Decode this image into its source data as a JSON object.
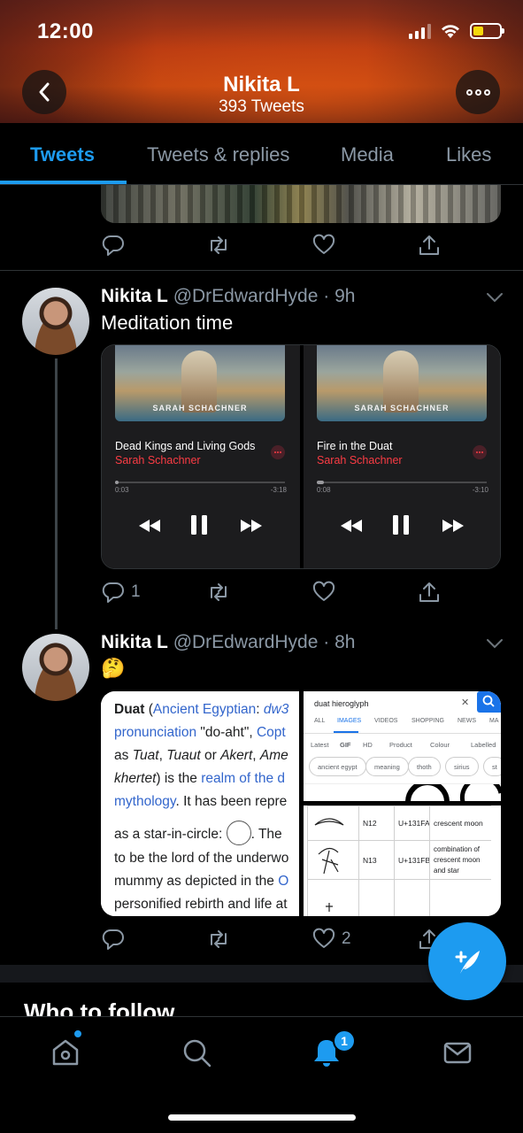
{
  "status": {
    "time": "12:00"
  },
  "header": {
    "name": "Nikita L",
    "tweet_count": "393 Tweets"
  },
  "tabs": [
    {
      "label": "Tweets",
      "active": true
    },
    {
      "label": "Tweets & replies",
      "active": false
    },
    {
      "label": "Media",
      "active": false
    },
    {
      "label": "Likes",
      "active": false
    }
  ],
  "tweets": [
    {
      "name": "Nikita L",
      "handle_time": "@DrEdwardHyde · 9h",
      "text": "Meditation time",
      "reply_count": "1",
      "retweet_count": "",
      "like_count": "",
      "music": [
        {
          "art_caption": "SARAH SCHACHNER",
          "title": "Dead Kings and Living Gods",
          "artist": "Sarah Schachner",
          "elapsed": "0:03",
          "remaining": "-3:18"
        },
        {
          "art_caption": "SARAH SCHACHNER",
          "title": "Fire in the Duat",
          "artist": "Sarah Schachner",
          "elapsed": "0:08",
          "remaining": "-3:10"
        }
      ]
    },
    {
      "name": "Nikita L",
      "handle_time": "@DrEdwardHyde · 8h",
      "text": "🤔",
      "reply_count": "",
      "retweet_count": "",
      "like_count": "2",
      "wiki": {
        "l1a": "Duat",
        "l1b": " (",
        "l1c": "Ancient Egyptian",
        "l1d": ": ",
        "l1e": "dw3",
        "l2a": "pronunciation",
        "l2b": " \"do-aht\", ",
        "l2c": "Copt",
        "l3a": "as ",
        "l3b": "Tuat",
        "l3c": ", ",
        "l3d": "Tuaut",
        "l3e": " or ",
        "l3f": "Akert",
        "l3g": ", ",
        "l3h": "Ame",
        "l4a": "khertet",
        "l4b": ") is the ",
        "l4c": "realm of the d",
        "l5a": "mythology",
        "l5b": ". It has been repre",
        "l6a": "as a star-in-circle: ",
        "l6b": ". The",
        "l7a": "to be the lord of the underwo",
        "l8a": "mummy as depicted in the ",
        "l8b": "O",
        "l9a": "personified rebirth and life at"
      },
      "search": {
        "query": "duat hieroglyph",
        "tabs": [
          "ALL",
          "IMAGES",
          "VIDEOS",
          "SHOPPING",
          "NEWS",
          "MA"
        ],
        "filters": [
          "Latest",
          "GIF",
          "HD",
          "Product",
          "Colour",
          "Labelled"
        ],
        "chips": [
          "ancient egypt",
          "meaning",
          "thoth",
          "sirius",
          "st"
        ]
      },
      "table": [
        {
          "code": "N12",
          "unicode": "U+131FA",
          "desc": "crescent moon"
        },
        {
          "code": "N13",
          "unicode": "U+131FB",
          "desc": "combination of crescent moon and star"
        }
      ]
    }
  ],
  "section": {
    "title": "Who to follow"
  },
  "nav": {
    "notifications_badge": "1"
  }
}
